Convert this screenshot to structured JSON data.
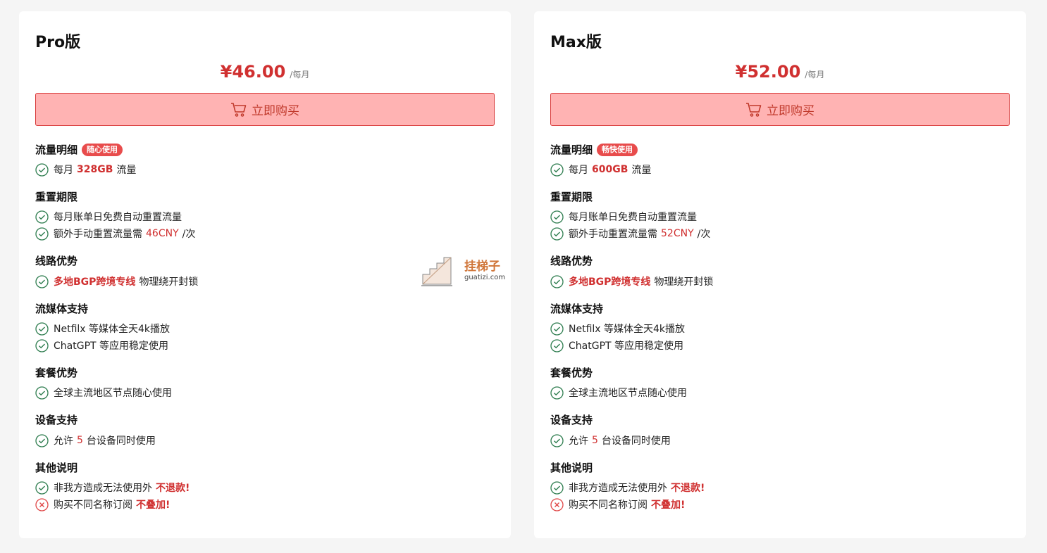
{
  "plans": [
    {
      "title": "Pro版",
      "price": "¥46.00",
      "period": "/每月",
      "buy_label": "立即购买",
      "traffic": {
        "title": "流量明细",
        "tag": "随心使用",
        "prefix": "每月",
        "value": "328GB",
        "suffix": "流量"
      },
      "reset": {
        "title": "重置期限",
        "item1": "每月账单日免费自动重置流量",
        "item2_prefix": "额外手动重置流量需",
        "item2_value": "46CNY",
        "item2_suffix": "/次"
      },
      "route": {
        "title": "线路优势",
        "highlight": "多地BGP跨境专线",
        "suffix": "物理绕开封锁"
      },
      "streaming": {
        "title": "流媒体支持",
        "item1": "Netfilx 等媒体全天4k播放",
        "item2": "ChatGPT 等应用稳定使用"
      },
      "package": {
        "title": "套餐优势",
        "item1": "全球主流地区节点随心使用"
      },
      "devices": {
        "title": "设备支持",
        "prefix": "允许",
        "value": "5",
        "suffix": "台设备同时使用"
      },
      "notes": {
        "title": "其他说明",
        "item1_prefix": "非我方造成无法使用外",
        "item1_bold": "不退款!",
        "item2_prefix": "购买不同名称订阅",
        "item2_bold": "不叠加!"
      }
    },
    {
      "title": "Max版",
      "price": "¥52.00",
      "period": "/每月",
      "buy_label": "立即购买",
      "traffic": {
        "title": "流量明细",
        "tag": "畅快使用",
        "prefix": "每月",
        "value": "600GB",
        "suffix": "流量"
      },
      "reset": {
        "title": "重置期限",
        "item1": "每月账单日免费自动重置流量",
        "item2_prefix": "额外手动重置流量需",
        "item2_value": "52CNY",
        "item2_suffix": "/次"
      },
      "route": {
        "title": "线路优势",
        "highlight": "多地BGP跨境专线",
        "suffix": "物理绕开封锁"
      },
      "streaming": {
        "title": "流媒体支持",
        "item1": "Netfilx 等媒体全天4k播放",
        "item2": "ChatGPT 等应用稳定使用"
      },
      "package": {
        "title": "套餐优势",
        "item1": "全球主流地区节点随心使用"
      },
      "devices": {
        "title": "设备支持",
        "prefix": "允许",
        "value": "5",
        "suffix": "台设备同时使用"
      },
      "notes": {
        "title": "其他说明",
        "item1_prefix": "非我方造成无法使用外",
        "item1_bold": "不退款!",
        "item2_prefix": "购买不同名称订阅",
        "item2_bold": "不叠加!"
      }
    }
  ],
  "watermark": {
    "cn": "挂梯子",
    "en": "guatizi.com"
  },
  "colors": {
    "accent": "#d03030",
    "button_bg": "#ffb3b3",
    "check": "#2e7d4f",
    "cross": "#e04848"
  }
}
